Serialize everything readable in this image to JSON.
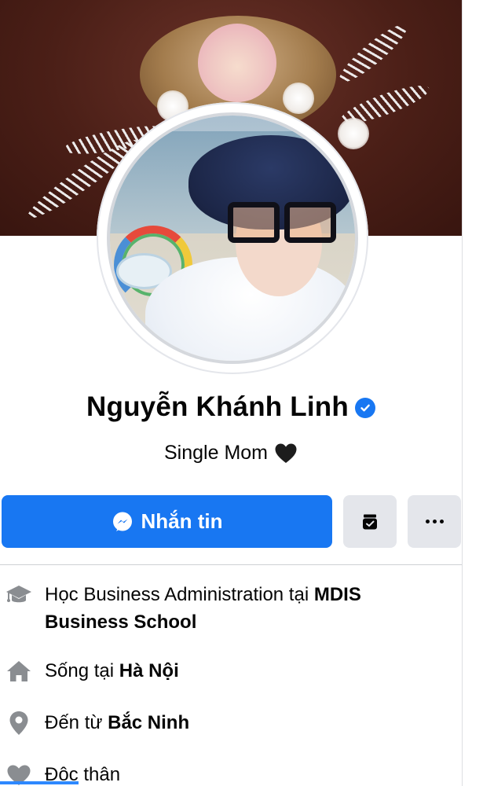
{
  "profile": {
    "name": "Nguyễn Khánh Linh",
    "bio": "Single Mom",
    "verified": true
  },
  "actions": {
    "message_label": "Nhắn tin",
    "primary_color": "#1877f2",
    "secondary_color": "#e4e6eb"
  },
  "details": {
    "education": {
      "prefix": "Học Business Administration tại ",
      "value": "MDIS Business School",
      "icon": "graduation-cap-icon"
    },
    "lives_in": {
      "prefix": "Sống tại ",
      "value": "Hà Nội",
      "icon": "home-icon"
    },
    "from": {
      "prefix": "Đến từ ",
      "value": "Bắc Ninh",
      "icon": "location-pin-icon"
    },
    "relationship": {
      "value": "Độc thân",
      "icon": "heart-icon"
    }
  }
}
